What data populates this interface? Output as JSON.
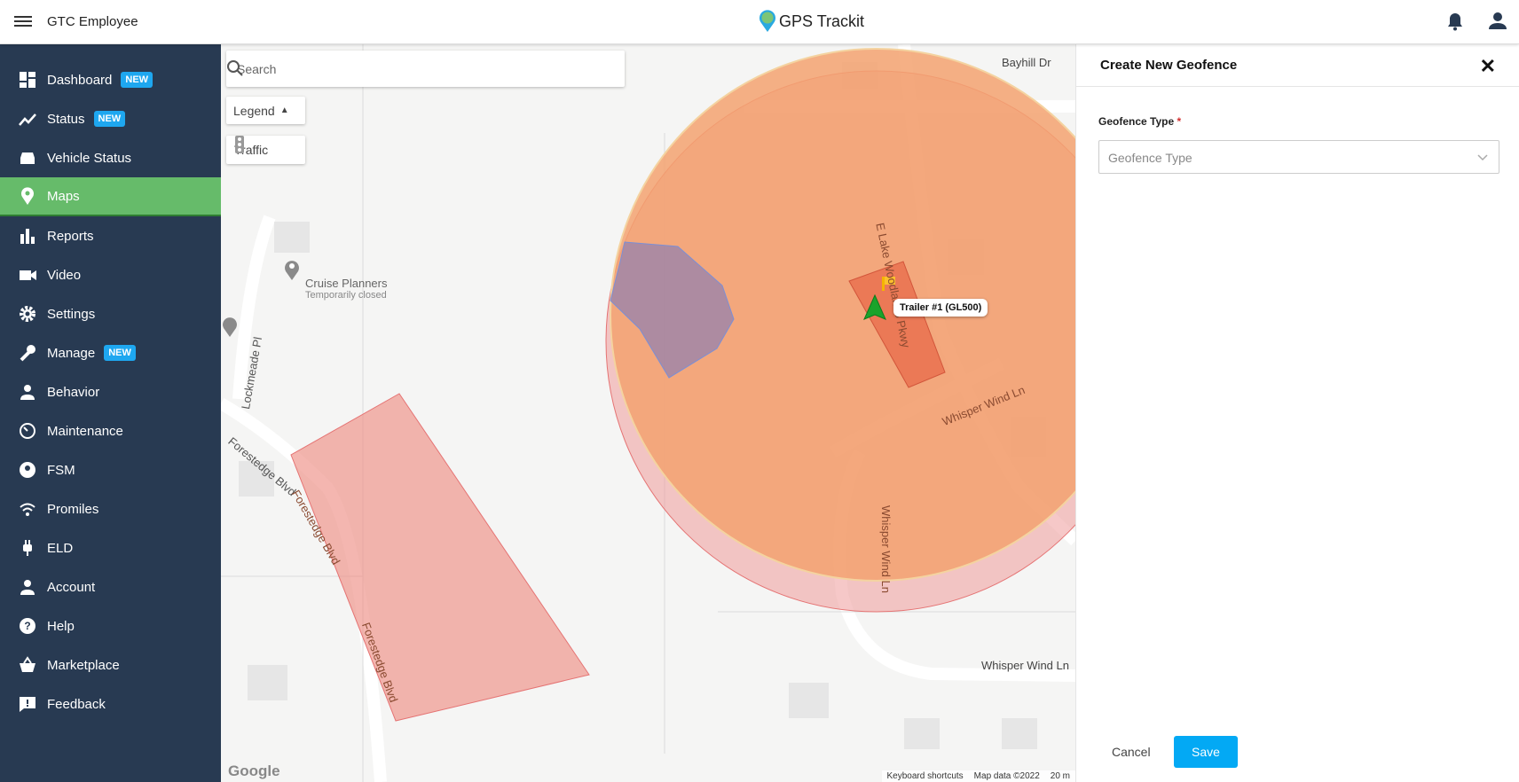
{
  "header": {
    "org": "GTC Employee",
    "logo": "GPS Trackit"
  },
  "sidebar": {
    "items": [
      {
        "label": "Dashboard",
        "badge": "NEW",
        "icon": "dashboard-icon"
      },
      {
        "label": "Status",
        "badge": "NEW",
        "icon": "status-icon"
      },
      {
        "label": "Vehicle Status",
        "icon": "car-icon"
      },
      {
        "label": "Maps",
        "icon": "map-pin-icon",
        "active": true
      },
      {
        "label": "Reports",
        "icon": "bar-chart-icon"
      },
      {
        "label": "Video",
        "icon": "video-icon"
      },
      {
        "label": "Settings",
        "icon": "gear-icon"
      },
      {
        "label": "Manage",
        "badge": "NEW",
        "icon": "wrench-icon"
      },
      {
        "label": "Behavior",
        "icon": "person-icon"
      },
      {
        "label": "Maintenance",
        "icon": "maintenance-icon"
      },
      {
        "label": "FSM",
        "icon": "account-circle-icon"
      },
      {
        "label": "Promiles",
        "icon": "signal-icon"
      },
      {
        "label": "ELD",
        "icon": "plug-icon"
      },
      {
        "label": "Account",
        "icon": "person-icon"
      },
      {
        "label": "Help",
        "icon": "help-icon"
      },
      {
        "label": "Marketplace",
        "icon": "basket-icon"
      },
      {
        "label": "Feedback",
        "icon": "feedback-icon"
      }
    ]
  },
  "map": {
    "search_placeholder": "Search",
    "legend": "Legend",
    "traffic": "Traffic",
    "marker_label": "Trailer #1 (GL500)",
    "poi": {
      "name": "Cruise Planners",
      "status": "Temporarily closed"
    },
    "streets": [
      "Bayhill Dr",
      "E Lake Woodlands Pkwy",
      "Whisper Wind Ln",
      "Whisper Wind Ln",
      "Whisper Wind Ln",
      "Lockmeade Pl",
      "Forestedge Blvd",
      "Forestedge Blvd",
      "Forestedge Blvd"
    ],
    "footer": {
      "shortcuts": "Keyboard shortcuts",
      "data": "Map data ©2022",
      "scale": "20 m"
    },
    "google": "Google",
    "colors": {
      "circle": "#f3a270",
      "polygon": "#ee8f85",
      "blue": "#7b8fd6"
    }
  },
  "panel": {
    "title": "Create New Geofence",
    "field_label": "Geofence Type",
    "required": "*",
    "select_placeholder": "Geofence Type",
    "cancel": "Cancel",
    "save": "Save"
  }
}
